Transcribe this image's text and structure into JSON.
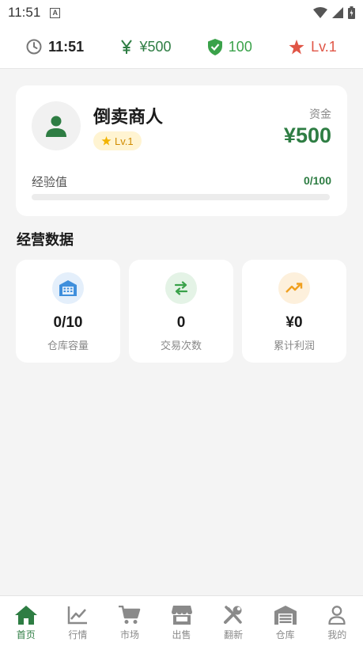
{
  "status_bar": {
    "time": "11:51",
    "a_badge": "A"
  },
  "info_bar": {
    "time": "11:51",
    "money": "¥500",
    "shield_value": "100",
    "level": "Lv.1"
  },
  "profile": {
    "name": "倒卖商人",
    "level": "Lv.1",
    "funds_label": "资金",
    "funds_value": "¥500",
    "exp_label": "经验值",
    "exp_value": "0/100",
    "exp_progress": 0
  },
  "section_title": "经营数据",
  "stats": [
    {
      "value": "0/10",
      "label": "仓库容量",
      "icon": "warehouse-icon"
    },
    {
      "value": "0",
      "label": "交易次数",
      "icon": "swap-icon"
    },
    {
      "value": "¥0",
      "label": "累计利润",
      "icon": "trending-up-icon"
    }
  ],
  "nav": [
    {
      "label": "首页",
      "icon": "home-icon",
      "active": true
    },
    {
      "label": "行情",
      "icon": "chart-line-icon",
      "active": false
    },
    {
      "label": "市场",
      "icon": "cart-icon",
      "active": false
    },
    {
      "label": "出售",
      "icon": "store-icon",
      "active": false
    },
    {
      "label": "翻新",
      "icon": "tools-icon",
      "active": false
    },
    {
      "label": "仓库",
      "icon": "warehouse-icon",
      "active": false
    },
    {
      "label": "我的",
      "icon": "person-icon",
      "active": false
    }
  ],
  "colors": {
    "primary_green": "#2e7d43",
    "shield_green": "#3aa24a",
    "level_red": "#e05546",
    "gold": "#d18b00"
  }
}
